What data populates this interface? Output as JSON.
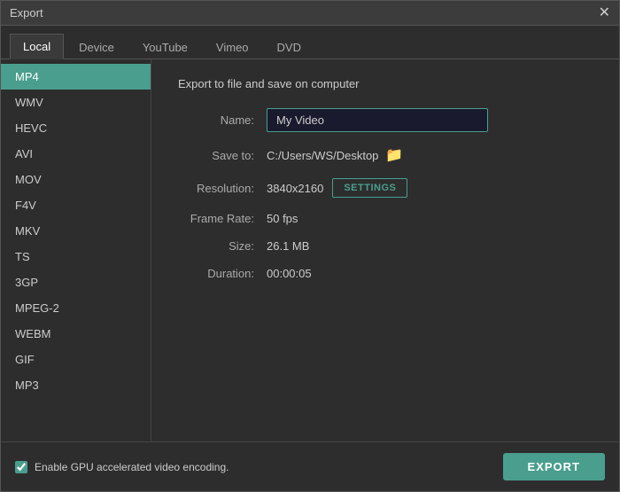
{
  "window": {
    "title": "Export",
    "close_label": "✕"
  },
  "tabs": [
    {
      "label": "Local",
      "active": true
    },
    {
      "label": "Device",
      "active": false
    },
    {
      "label": "YouTube",
      "active": false
    },
    {
      "label": "Vimeo",
      "active": false
    },
    {
      "label": "DVD",
      "active": false
    }
  ],
  "sidebar": {
    "items": [
      {
        "label": "MP4",
        "active": true
      },
      {
        "label": "WMV",
        "active": false
      },
      {
        "label": "HEVC",
        "active": false
      },
      {
        "label": "AVI",
        "active": false
      },
      {
        "label": "MOV",
        "active": false
      },
      {
        "label": "F4V",
        "active": false
      },
      {
        "label": "MKV",
        "active": false
      },
      {
        "label": "TS",
        "active": false
      },
      {
        "label": "3GP",
        "active": false
      },
      {
        "label": "MPEG-2",
        "active": false
      },
      {
        "label": "WEBM",
        "active": false
      },
      {
        "label": "GIF",
        "active": false
      },
      {
        "label": "MP3",
        "active": false
      }
    ]
  },
  "main": {
    "export_title": "Export to file and save on computer",
    "name_label": "Name:",
    "name_value": "My Video",
    "save_to_label": "Save to:",
    "save_to_path": "C:/Users/WS/Desktop",
    "resolution_label": "Resolution:",
    "resolution_value": "3840x2160",
    "settings_label": "SETTINGS",
    "frame_rate_label": "Frame Rate:",
    "frame_rate_value": "50 fps",
    "size_label": "Size:",
    "size_value": "26.1 MB",
    "duration_label": "Duration:",
    "duration_value": "00:00:05"
  },
  "footer": {
    "checkbox_label": "Enable GPU accelerated video encoding.",
    "export_label": "EXPORT"
  },
  "colors": {
    "accent": "#4a9e8e"
  }
}
